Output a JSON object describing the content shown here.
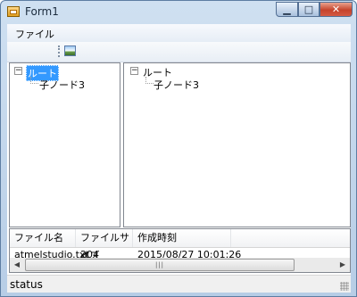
{
  "window": {
    "title": "Form1"
  },
  "menu": {
    "file_label": "ファイル"
  },
  "tree_left": {
    "root_label": "ルート",
    "child_label": "子ノード3"
  },
  "tree_right": {
    "root_label": "ルート",
    "child_label": "子ノード3"
  },
  "list": {
    "columns": [
      "ファイル名",
      "ファイルサイズ",
      "作成時刻"
    ],
    "rows": [
      {
        "name": "atmelstudio.txt",
        "size": "204",
        "created": "2015/08/27 10:01:26"
      }
    ]
  },
  "status": {
    "text": "status"
  }
}
